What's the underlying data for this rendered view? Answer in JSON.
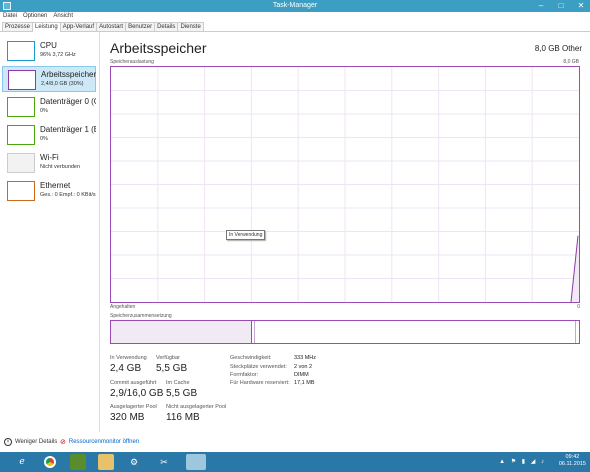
{
  "window": {
    "title": "Task-Manager",
    "minimize": "–",
    "maximize": "□",
    "close": "✕"
  },
  "menu": [
    "Datei",
    "Optionen",
    "Ansicht"
  ],
  "tabs": [
    "Prozesse",
    "Leistung",
    "App-Verlauf",
    "Autostart",
    "Benutzer",
    "Details",
    "Dienste"
  ],
  "active_tab": "Leistung",
  "sidebar": [
    {
      "name": "CPU",
      "sub": "96%  3,72 GHz",
      "color": "#1c9bd1"
    },
    {
      "name": "Arbeitsspeicher",
      "sub": "2,4/8,0 GB (30%)",
      "color": "#8b3aa8"
    },
    {
      "name": "Datenträger 0 (C:)",
      "sub": "0%",
      "color": "#4da60c"
    },
    {
      "name": "Datenträger 1 (E: F",
      "sub": "0%",
      "color": "#4da60c"
    },
    {
      "name": "Wi-Fi",
      "sub": "Nicht verbunden",
      "color": "#cccccc"
    },
    {
      "name": "Ethernet",
      "sub": "Ges.: 0  Empf.: 0 KBit/s",
      "color": "#c86a1e"
    }
  ],
  "main": {
    "title": "Arbeitsspeicher",
    "total": "8,0 GB Other",
    "graph_label": "Speicherauslastung",
    "graph_max": "8,0 GB",
    "graph_bottom_label": "Angehalten",
    "graph_bottom_right": "0",
    "comp_label": "Speicherzusammensetzung",
    "tooltip": "In Verwendung",
    "usage_fraction_end": 0.3
  },
  "stats": {
    "in_use_label": "In Verwendung",
    "in_use": "2,4 GB",
    "available_label": "Verfügbar",
    "available": "5,5 GB",
    "commit_label": "Commit ausgeführt",
    "commit": "2,9/16,0 GB",
    "cache_label": "Im Cache",
    "cache": "5,5 GB",
    "paged_label": "Ausgelagerter Pool",
    "paged": "320 MB",
    "nonpaged_label": "Nicht ausgelagerter Pool",
    "nonpaged": "116 MB"
  },
  "details": [
    {
      "label": "Geschwindigkeit:",
      "value": "333 MHz"
    },
    {
      "label": "Steckplätze verwendet:",
      "value": "2 von 2"
    },
    {
      "label": "Formfaktor:",
      "value": "DIMM"
    },
    {
      "label": "Für Hardware reserviert:",
      "value": "17,1 MB"
    }
  ],
  "footer": {
    "less_details": "Weniger Details",
    "resource_monitor": "Ressourcenmonitor öffnen"
  },
  "taskbar": {
    "time": "09:42",
    "date": "06.11.2015",
    "tray": "▲ ⚑ ▮ ◢ ♪"
  }
}
